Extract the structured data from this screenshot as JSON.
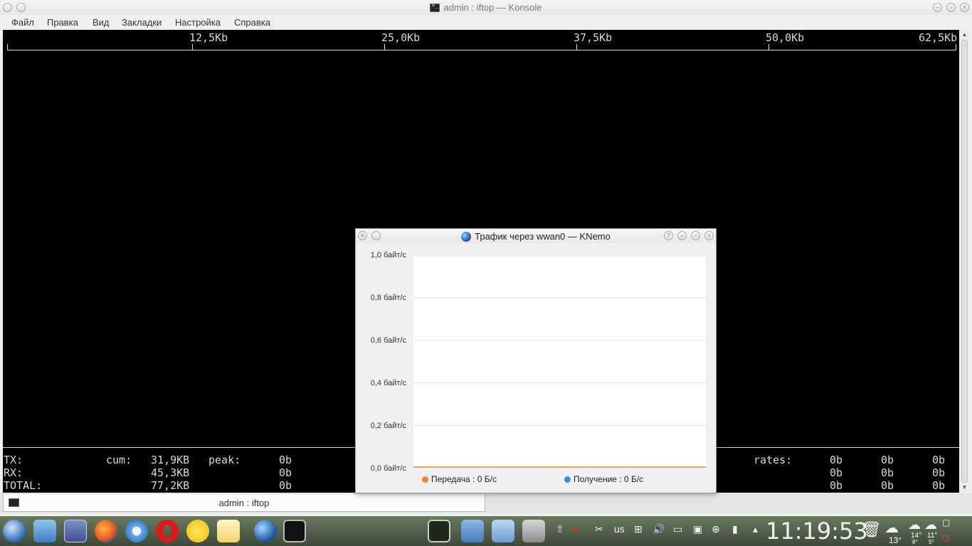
{
  "konsole": {
    "title": "admin : iftop — Konsole",
    "menu": [
      "Файл",
      "Правка",
      "Вид",
      "Закладки",
      "Настройка",
      "Справка"
    ],
    "scale_labels": [
      "12,5Kb",
      "25,0Kb",
      "37,5Kb",
      "50,0Kb",
      "62,5Kb"
    ],
    "stats": {
      "tx": {
        "label": "TX:",
        "cum_label": "cum:",
        "cum": "31,9KB",
        "peak_label": "peak:",
        "peak": "0b",
        "rates_label": "rates:",
        "rates": [
          "0b",
          "0b",
          "0b"
        ]
      },
      "rx": {
        "label": "RX:",
        "cum": "45,3KB",
        "peak": "0b",
        "rates": [
          "0b",
          "0b",
          "0b"
        ]
      },
      "total": {
        "label": "TOTAL:",
        "cum": "77,2KB",
        "peak": "0b",
        "rates": [
          "0b",
          "0b",
          "0b"
        ]
      }
    },
    "tab_label": "admin : iftop"
  },
  "knemo": {
    "title": "Трафик через wwan0 — KNemo",
    "y_labels": [
      "1,0 байт/с",
      "0,8 байт/с",
      "0,6 байт/с",
      "0,4 байт/с",
      "0,2 байт/с",
      "0,0 байт/с"
    ],
    "legend": {
      "tx": "Передача : 0 Б/с",
      "rx": "Получение : 0 Б/с",
      "tx_color": "#f5821f",
      "rx_color": "#2f8fe8"
    }
  },
  "taskbar": {
    "apps": [
      "app-launcher-icon",
      "file-manager-icon",
      "desktop-selector-icon",
      "firefox-icon",
      "chromium-icon",
      "opera-icon",
      "chat-icon",
      "mail-icon",
      "network-globe-icon",
      "terminal-icon"
    ],
    "tasks": [
      "system-monitor-icon",
      "screenshot-icon",
      "desktop-pager-icon",
      "settings-icon"
    ],
    "keyboard_layout": "us",
    "clock": "11:19:53",
    "weather_now": "13°",
    "weather_f1_hi": "14°",
    "weather_f1_lo": "8°",
    "weather_f2_hi": "11°",
    "weather_f2_lo": "5°"
  }
}
